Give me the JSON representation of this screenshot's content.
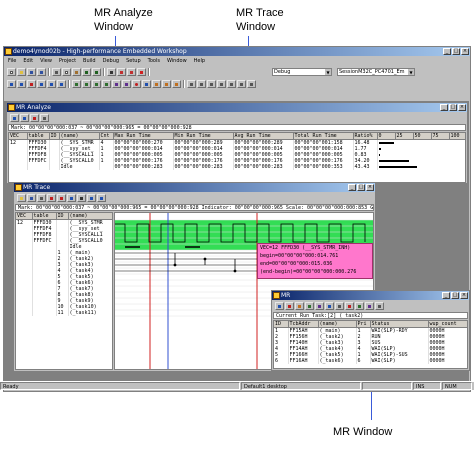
{
  "callouts": {
    "analyze": "MR Analyze\nWindow",
    "trace": "MR Trace\nWindow",
    "mr": "MR Window"
  },
  "app": {
    "title": "demo4\\mod02b - High-performance Embedded Workshop",
    "menus": [
      "File",
      "Edit",
      "View",
      "Project",
      "Build",
      "Debug",
      "Setup",
      "Tools",
      "Window",
      "Help"
    ],
    "config_combo": "Debug",
    "session_combo": "SessionM32C_PC4701_Em"
  },
  "analyze": {
    "title": "MR Analyze",
    "mark": "Mark: 00\"00\"00\"000:037 ~ 00\"00\"00\"000:965 = 00\"00\"00\"000:928",
    "columns": [
      "VEC",
      "table",
      "ID",
      "(name)",
      "Cnt",
      "Max Run Time",
      "Min Run Time",
      "Avg Run Time",
      "Total Run Time",
      "Ratio%",
      "0",
      "25",
      "50",
      "75",
      "100"
    ],
    "rows": [
      [
        "12",
        "FFFD30",
        "",
        "(__SYS_STMR",
        "4",
        "00\"00\"00\"000:270",
        "00\"00\"00\"000:289",
        "00\"00\"00\"000:289",
        "00\"00\"00\"001:158",
        "16.48",
        16.48
      ],
      [
        "",
        "FFFDF4",
        "",
        "(__syy_set_",
        "1",
        "00\"00\"00\"000:014",
        "00\"00\"00\"000:014",
        "00\"00\"00\"000:014",
        "00\"00\"00\"000:014",
        "1.77",
        1.77
      ],
      [
        "",
        "FFFDF8",
        "",
        "(__SYSCALL1",
        "1",
        "00\"00\"00\"000:005",
        "00\"00\"00\"000:005",
        "00\"00\"00\"000:005",
        "00\"00\"00\"000:005",
        "0.83",
        0.83
      ],
      [
        "",
        "FFFDFC",
        "",
        "(__SYSCALL0",
        "1",
        "00\"00\"00\"000:176",
        "00\"00\"00\"000:176",
        "00\"00\"00\"000:176",
        "00\"00\"00\"000:176",
        "34.20",
        34.2
      ],
      [
        "",
        "",
        "",
        "Idle",
        "",
        "00\"00\"00\"000:283",
        "00\"00\"00\"000:283",
        "00\"00\"00\"000:283",
        "00\"00\"00\"000:353",
        "43.43",
        43.43
      ]
    ]
  },
  "trace": {
    "title": "MR Trace",
    "mark": "Mark: 00\"00\"00\"000:037 ~ 00\"00\"00\"000:965 = 00\"00\"00\"000:928  Indicator: 00\"00\"00\"000:965  Scale: 00\"00\"00\"000:000:853  Grid: 00\"00\"00\"000:245  Area Break",
    "columns": [
      "VEC",
      "table",
      "ID",
      "(name)"
    ],
    "rows": [
      [
        "12",
        "FFFD30",
        "",
        "(__SYS_STMR"
      ],
      [
        "",
        "FFFDF4",
        "",
        "(__syy_set_"
      ],
      [
        "",
        "FFFDF8",
        "",
        "(__SYSCALL1"
      ],
      [
        "",
        "FFFDFC",
        "",
        "(__SYSCALL0"
      ],
      [
        "",
        "",
        "",
        "Idle"
      ],
      [
        "",
        "",
        "1",
        "(_main)"
      ],
      [
        "",
        "",
        "2",
        "(_task2)"
      ],
      [
        "",
        "",
        "3",
        "(_task3)"
      ],
      [
        "",
        "",
        "4",
        "(_task4)"
      ],
      [
        "",
        "",
        "5",
        "(_task5)"
      ],
      [
        "",
        "",
        "6",
        "(_task6)"
      ],
      [
        "",
        "",
        "7",
        "(_task7)"
      ],
      [
        "",
        "",
        "8",
        "(_task8)"
      ],
      [
        "",
        "",
        "9",
        "(_task9)"
      ],
      [
        "",
        "",
        "10",
        "(_task10)"
      ],
      [
        "",
        "",
        "11",
        "(_task11)"
      ]
    ],
    "tooltip": [
      "VEC=12 FFFD30 (__SYS_STMR_INH)",
      "begin=00\"00\"00\"000:014.761",
      "end=00\"00\"00\"000:015.036",
      "(end-begin)=00\"00\"00\"000:000.276"
    ]
  },
  "mr": {
    "title": "MR",
    "current_task": "Current Run Task:[2] (_task2)",
    "columns": [
      "ID",
      "TcbAddr",
      "(name)",
      "Pri",
      "Status",
      "wup_count"
    ],
    "rows": [
      [
        "1",
        "FF15AH",
        "(_main)",
        "1",
        "WAI(SLP)-RDY",
        "0000H"
      ],
      [
        "2",
        "FF156H",
        "(_task2)",
        "2",
        "RUN",
        "0000H"
      ],
      [
        "3",
        "FF140H",
        "(_task3)",
        "3",
        "SUS",
        "0000H"
      ],
      [
        "4",
        "FF14AH",
        "(_task4)",
        "4",
        "WAI(SLP)",
        "0000H"
      ],
      [
        "5",
        "FF166H",
        "(_task5)",
        "1",
        "WAI(SLP)-SUS",
        "0000H"
      ],
      [
        "6",
        "FF16AH",
        "(_task6)",
        "6",
        "WAI(SLP)",
        "0000H"
      ]
    ]
  },
  "status": {
    "ready": "Ready",
    "desktop": "Default1 desktop",
    "ins": "INS",
    "num": "NUM"
  }
}
